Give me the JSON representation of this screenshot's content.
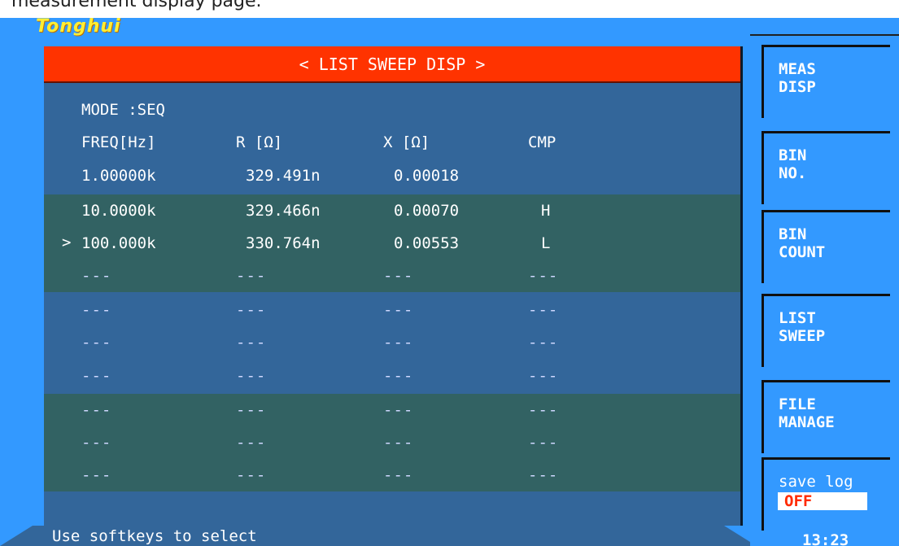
{
  "caption": "measurement display page.",
  "brand": "Tonghui",
  "title": "< LIST SWEEP DISP >",
  "mode_text": "MODE :SEQ",
  "columns": [
    "FREQ[Hz]",
    "R [Ω]",
    "X [Ω]",
    "CMP"
  ],
  "rows": [
    {
      "freq": "1.00000k",
      "r": "329.491n",
      "x": "0.00018",
      "cmp": ""
    },
    {
      "freq": "10.0000k",
      "r": "329.466n",
      "x": "0.00070",
      "cmp": "H"
    },
    {
      "freq": "100.000k",
      "r": "330.764n",
      "x": "0.00553",
      "cmp": "L"
    }
  ],
  "cursor_symbol": ">",
  "empty_placeholder": "---",
  "status_text": "Use softkeys to select",
  "softkeys": [
    {
      "label": "MEAS\nDISP"
    },
    {
      "label": "BIN\nNO."
    },
    {
      "label": "BIN\nCOUNT"
    },
    {
      "label": "LIST\nSWEEP"
    },
    {
      "label": "FILE\nMANAGE"
    },
    {
      "label": "save log",
      "state": "OFF"
    }
  ],
  "clock": "13:23",
  "colors": {
    "screen_bg": "#3399ff",
    "panel_bg": "#33669a",
    "alt_row_bg": "#326263",
    "title_bg": "#ff3300",
    "state_text": "#ff2a00"
  }
}
